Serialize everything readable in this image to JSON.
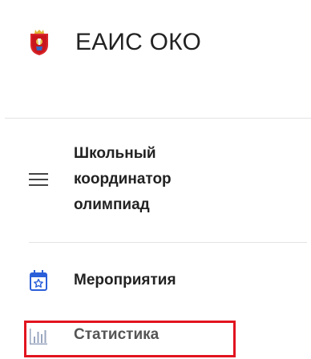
{
  "header": {
    "title": "ЕАИС ОКО",
    "logo_icon": "moscow-oblast-coat-of-arms-icon"
  },
  "role": {
    "icon": "hamburger-menu-icon",
    "lines": [
      "Школьный",
      "координатор",
      "олимпиад"
    ]
  },
  "nav": {
    "items": [
      {
        "label": "Мероприятия",
        "icon": "calendar-star-icon"
      },
      {
        "label": "Статистика",
        "icon": "bar-chart-icon"
      }
    ]
  },
  "colors": {
    "accent_blue": "#2b5fd9",
    "highlight_red": "#e1141f",
    "text": "#222222",
    "divider": "#e3e3e3"
  }
}
